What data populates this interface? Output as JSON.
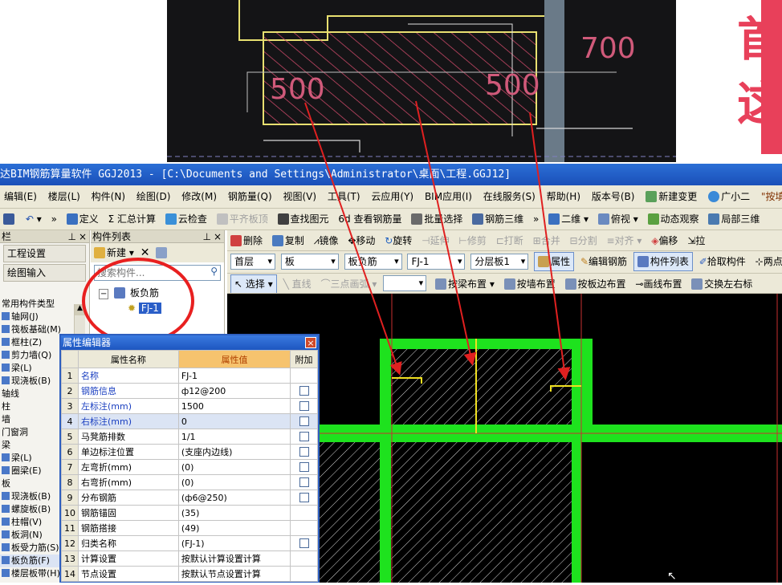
{
  "photo": {
    "label_500_left": "500",
    "label_500_right": "500",
    "label_700": "700"
  },
  "banner": {
    "chars": [
      "首",
      "这"
    ]
  },
  "titlebar": {
    "text": "达BIM钢筋算量软件 GGJ2013 - [C:\\Documents and Settings\\Administrator\\桌面\\工程.GGJ12]"
  },
  "menu": [
    "编辑(E)",
    "楼层(L)",
    "构件(N)",
    "绘图(D)",
    "修改(M)",
    "钢筋量(Q)",
    "视图(V)",
    "工具(T)",
    "云应用(Y)",
    "BIM应用(I)",
    "在线服务(S)",
    "帮助(H)",
    "版本号(B)",
    "新建变更",
    "广小二",
    "\"按填写"
  ],
  "toolbar1": [
    "定义",
    "汇总计算",
    "云检查",
    "平齐板顶",
    "查找图元",
    "查看钢筋量",
    "批量选择",
    "钢筋三维",
    "二维",
    "俯视",
    "动态观察",
    "局部三维"
  ],
  "leftnav": {
    "header": "栏",
    "buttons": [
      "工程设置",
      "绘图输入"
    ],
    "items": [
      "常用构件类型",
      "轴网(J)",
      "筏板基础(M)",
      "框柱(Z)",
      "剪力墙(Q)",
      "梁(L)",
      "现浇板(B)",
      "轴线",
      "柱",
      "墙",
      "门窗洞",
      "梁",
      "梁(L)",
      "圈梁(E)",
      "板",
      "现浇板(B)",
      "螺旋板(B)",
      "柱帽(V)",
      "板洞(N)",
      "板受力筋(S)",
      "板负筋(F)",
      "楼层板带(H)"
    ]
  },
  "complist": {
    "header": "构件列表",
    "new_label": "新建",
    "search_placeholder": "搜索构件...",
    "tree_parent": "板负筋",
    "tree_child": "FJ-1"
  },
  "toolbar2": [
    "删除",
    "复制",
    "镜像",
    "移动",
    "旋转",
    "延伸",
    "修剪",
    "打断",
    "合并",
    "分割",
    "对齐",
    "偏移",
    "拉"
  ],
  "toolbar3": {
    "selects": [
      "首层",
      "板",
      "板负筋",
      "FJ-1",
      "分层板1"
    ],
    "buttons": [
      "属性",
      "编辑钢筋",
      "构件列表",
      "拾取构件",
      "两点"
    ]
  },
  "toolbar4": [
    "选择",
    "直线",
    "三点画弧",
    "按梁布置",
    "按墙布置",
    "按板边布置",
    "画线布置",
    "交换左右标"
  ],
  "propeditor": {
    "title": "属性编辑器",
    "col_name": "属性名称",
    "col_value": "属性值",
    "col_extra": "附加",
    "rows": [
      {
        "idx": "1",
        "name": "名称",
        "value": "FJ-1",
        "blue": true,
        "check": false
      },
      {
        "idx": "2",
        "name": "钢筋信息",
        "value": "ф12@200",
        "blue": true,
        "check": true
      },
      {
        "idx": "3",
        "name": "左标注(mm)",
        "value": "1500",
        "blue": true,
        "check": true
      },
      {
        "idx": "4",
        "name": "右标注(mm)",
        "value": "0",
        "blue": true,
        "check": true,
        "hl": true
      },
      {
        "idx": "5",
        "name": "马凳筋排数",
        "value": "1/1",
        "blue": false,
        "check": true
      },
      {
        "idx": "6",
        "name": "单边标注位置",
        "value": "(支座内边线)",
        "blue": false,
        "check": true
      },
      {
        "idx": "7",
        "name": "左弯折(mm)",
        "value": "(0)",
        "blue": false,
        "check": true
      },
      {
        "idx": "8",
        "name": "右弯折(mm)",
        "value": "(0)",
        "blue": false,
        "check": true
      },
      {
        "idx": "9",
        "name": "分布钢筋",
        "value": "(ф6@250)",
        "blue": false,
        "check": true
      },
      {
        "idx": "10",
        "name": "钢筋锚固",
        "value": "(35)",
        "blue": false,
        "check": false
      },
      {
        "idx": "11",
        "name": "钢筋搭接",
        "value": "(49)",
        "blue": false,
        "check": false
      },
      {
        "idx": "12",
        "name": "归类名称",
        "value": "(FJ-1)",
        "blue": false,
        "check": true
      },
      {
        "idx": "13",
        "name": "计算设置",
        "value": "按默认计算设置计算",
        "blue": false,
        "check": false
      },
      {
        "idx": "14",
        "name": "节点设置",
        "value": "按默认节点设置计算",
        "blue": false,
        "check": false
      }
    ]
  }
}
